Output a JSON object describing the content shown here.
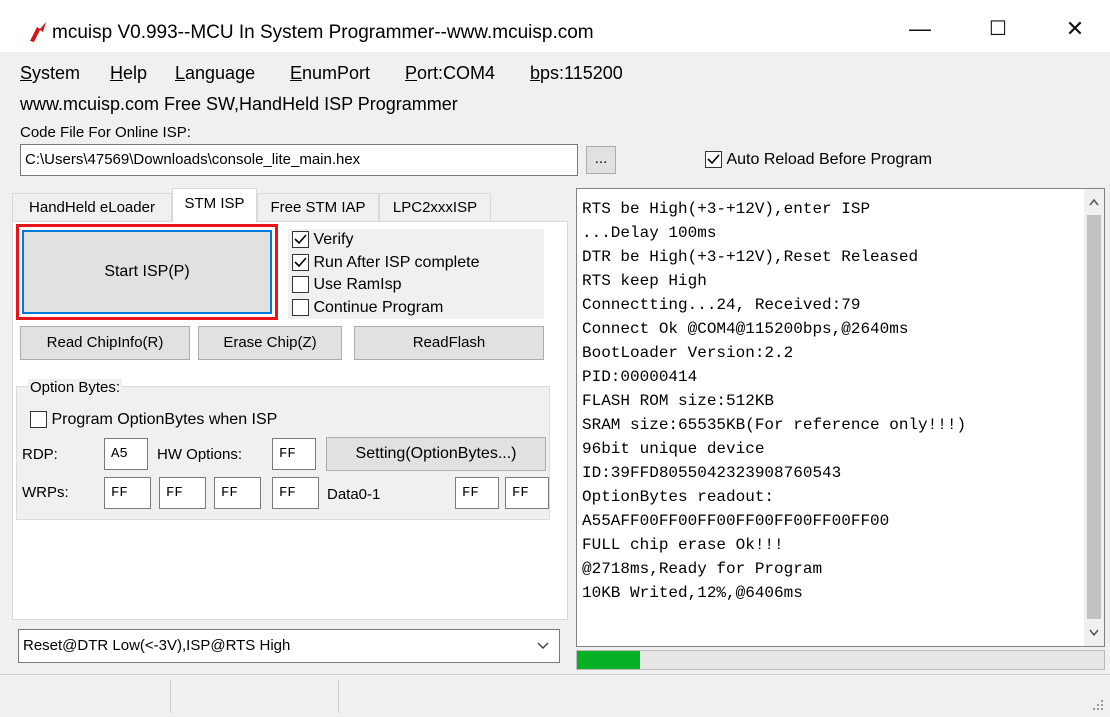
{
  "window": {
    "title": "mcuisp V0.993--MCU In System Programmer--www.mcuisp.com",
    "minimize": "—",
    "maximize": "☐",
    "close": "✕"
  },
  "menu": [
    {
      "label": "System",
      "u": "S",
      "rest": "ystem"
    },
    {
      "label": "Help",
      "u": "H",
      "rest": "elp"
    },
    {
      "label": "Language",
      "u": "L",
      "rest": "anguage"
    },
    {
      "label": "EnumPort",
      "u": "E",
      "rest": "numPort"
    },
    {
      "label": "Port:COM4",
      "u": "P",
      "rest": "ort:COM4"
    },
    {
      "label": "bps:115200",
      "u": "b",
      "rest": "ps:115200"
    }
  ],
  "site_line": "www.mcuisp.com Free SW,HandHeld ISP Programmer",
  "code_file": {
    "label": "Code File For Online ISP:",
    "path": "C:\\Users\\47569\\Downloads\\console_lite_main.hex",
    "browse": "...",
    "auto_reload": "Auto Reload Before Program",
    "auto_reload_checked": true
  },
  "tabs": [
    "HandHeld eLoader",
    "STM ISP",
    "Free STM IAP",
    "LPC2xxxISP"
  ],
  "active_tab": "STM ISP",
  "stm_isp": {
    "start_isp": "Start ISP(P)",
    "options": [
      {
        "label": "Verify",
        "checked": true
      },
      {
        "label": "Run After ISP complete",
        "checked": true
      },
      {
        "label": "Use RamIsp",
        "checked": false
      },
      {
        "label": "Continue Program",
        "checked": false
      }
    ],
    "read_chip_info": "Read ChipInfo(R)",
    "erase_chip": "Erase Chip(Z)",
    "read_flash": "ReadFlash"
  },
  "option_bytes": {
    "group_label": "Option Bytes:",
    "program_when_isp": "Program OptionBytes when ISP",
    "program_when_isp_checked": false,
    "rdp_label": "RDP:",
    "rdp_value": "A5",
    "hw_label": "HW Options:",
    "hw_value": "FF",
    "setting_button": "Setting(OptionBytes...)",
    "wrps_label": "WRPs:",
    "wrps": [
      "FF",
      "FF",
      "FF",
      "FF"
    ],
    "data_label": "Data0-1",
    "data": [
      "FF",
      "FF"
    ]
  },
  "reset_mode": "Reset@DTR Low(<-3V),ISP@RTS High",
  "log": [
    "RTS be High(+3-+12V),enter ISP",
    "...Delay 100ms",
    "DTR be High(+3-+12V),Reset Released",
    "RTS keep High",
    "Connectting...24, Received:79",
    "Connect Ok @COM4@115200bps,@2640ms",
    "BootLoader Version:2.2",
    "PID:00000414",
    "FLASH ROM size:512KB",
    "SRAM size:65535KB(For reference only!!!)",
    "96bit unique device",
    "ID:39FFD8055042323908760543",
    "OptionBytes readout:",
    "A55AFF00FF00FF00FF00FF00FF00FF00",
    "FULL chip erase Ok!!!",
    "@2718ms,Ready for Program",
    "10KB Writed,12%,@6406ms"
  ],
  "progress": {
    "percent": 12,
    "color": "#06b025"
  },
  "colors": {
    "highlight": "#e8141b",
    "app_icon": "#d7141a",
    "focus": "#0078d7"
  }
}
